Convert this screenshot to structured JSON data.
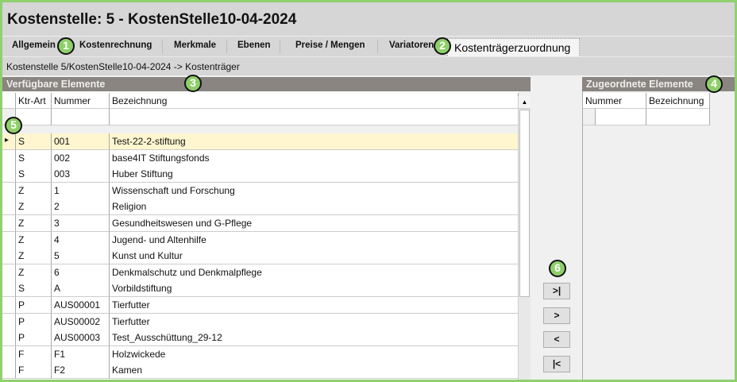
{
  "title": "Kostenstelle: 5 - KostenStelle10-04-2024",
  "tabs": [
    "Allgemein",
    "Kostenrechnung",
    "Merkmale",
    "Ebenen",
    "Preise / Mengen",
    "Variatoren",
    "Kostenträgerzuordnung"
  ],
  "active_tab": "Kostenträgerzuordnung",
  "breadcrumb": "Kostenstelle 5/KostenStelle10-04-2024 -> Kostenträger",
  "available": {
    "title": "Verfügbare Elemente",
    "columns": [
      "Ktr-Art",
      "Nummer",
      "Bezeichnung"
    ],
    "rows": [
      [
        "S",
        "001",
        "Test-22-2-stiftung"
      ],
      [
        "S",
        "002",
        "base4IT Stiftungsfonds"
      ],
      [
        "S",
        "003",
        "Huber Stiftung"
      ],
      [
        "Z",
        "1",
        "Wissenschaft und Forschung"
      ],
      [
        "Z",
        "2",
        "Religion"
      ],
      [
        "Z",
        "3",
        "Gesundheitswesen und G-Pflege"
      ],
      [
        "Z",
        "4",
        "Jugend- und Altenhilfe"
      ],
      [
        "Z",
        "5",
        "Kunst und Kultur"
      ],
      [
        "Z",
        "6",
        "Denkmalschutz und Denkmalpflege"
      ],
      [
        "S",
        "A",
        "Vorbildstiftung"
      ],
      [
        "P",
        "AUS00001",
        "Tierfutter"
      ],
      [
        "P",
        "AUS00002",
        "Tierfutter"
      ],
      [
        "P",
        "AUS00003",
        "Test_Ausschüttung_29-12"
      ],
      [
        "F",
        "F1",
        "Holzwickede"
      ],
      [
        "F",
        "F2",
        "Kamen"
      ]
    ],
    "selected_row": 0
  },
  "assigned": {
    "title": "Zugeordnete Elemente",
    "columns": [
      "Nummer",
      "Bezeichnung"
    ]
  },
  "buttons": {
    "add_all": ">|",
    "add": ">",
    "remove": "<",
    "remove_all": "|<"
  },
  "badges": [
    "1",
    "2",
    "3",
    "4",
    "5",
    "6"
  ],
  "colors": {
    "accent": "#8fcf6a",
    "selected_row": "#fff6d0",
    "header": "#8a8580"
  }
}
